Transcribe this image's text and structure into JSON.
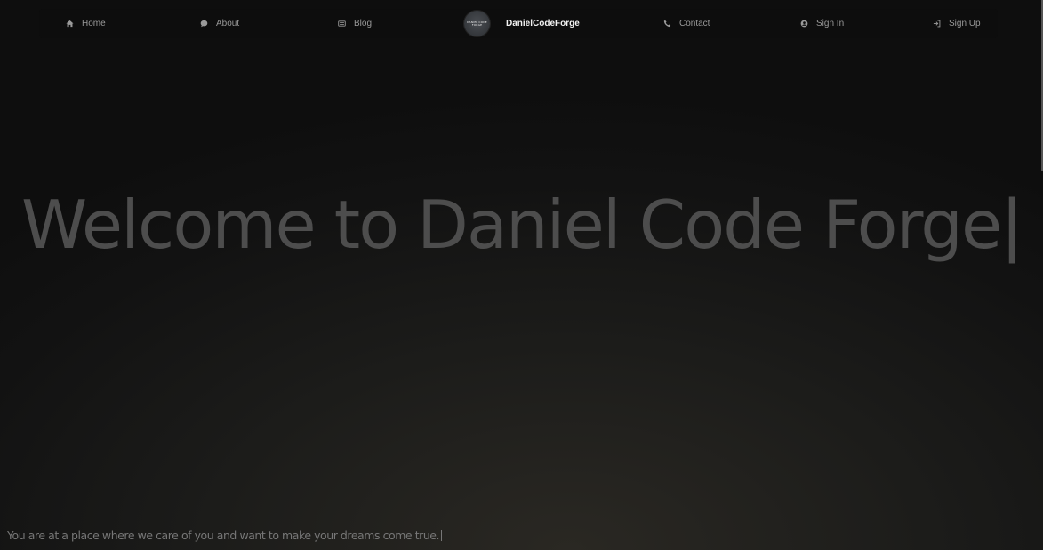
{
  "navbar": {
    "items_left": [
      {
        "label": "Home",
        "icon": "home-icon"
      },
      {
        "label": "About",
        "icon": "chat-bubble-icon"
      },
      {
        "label": "Blog",
        "icon": "newspaper-icon"
      }
    ],
    "brand": {
      "name": "DanielCodeForge",
      "logo_text": "DANIEL CODE FORGE"
    },
    "items_right": [
      {
        "label": "Contact",
        "icon": "phone-icon"
      },
      {
        "label": "Sign In",
        "icon": "user-circle-icon"
      },
      {
        "label": "Sign Up",
        "icon": "sign-in-arrow-icon"
      }
    ]
  },
  "hero": {
    "title": "Welcome to Daniel Code Forge",
    "caret": "|",
    "tagline": "You are at a place where we care of you and want to make your dreams come true."
  },
  "colors": {
    "background": "#1c1c1a",
    "navbar": "#0d0d0d",
    "title_text": "#4d4d4d",
    "nav_text": "#9a9a9a",
    "brand_text": "#f2f2f2"
  }
}
